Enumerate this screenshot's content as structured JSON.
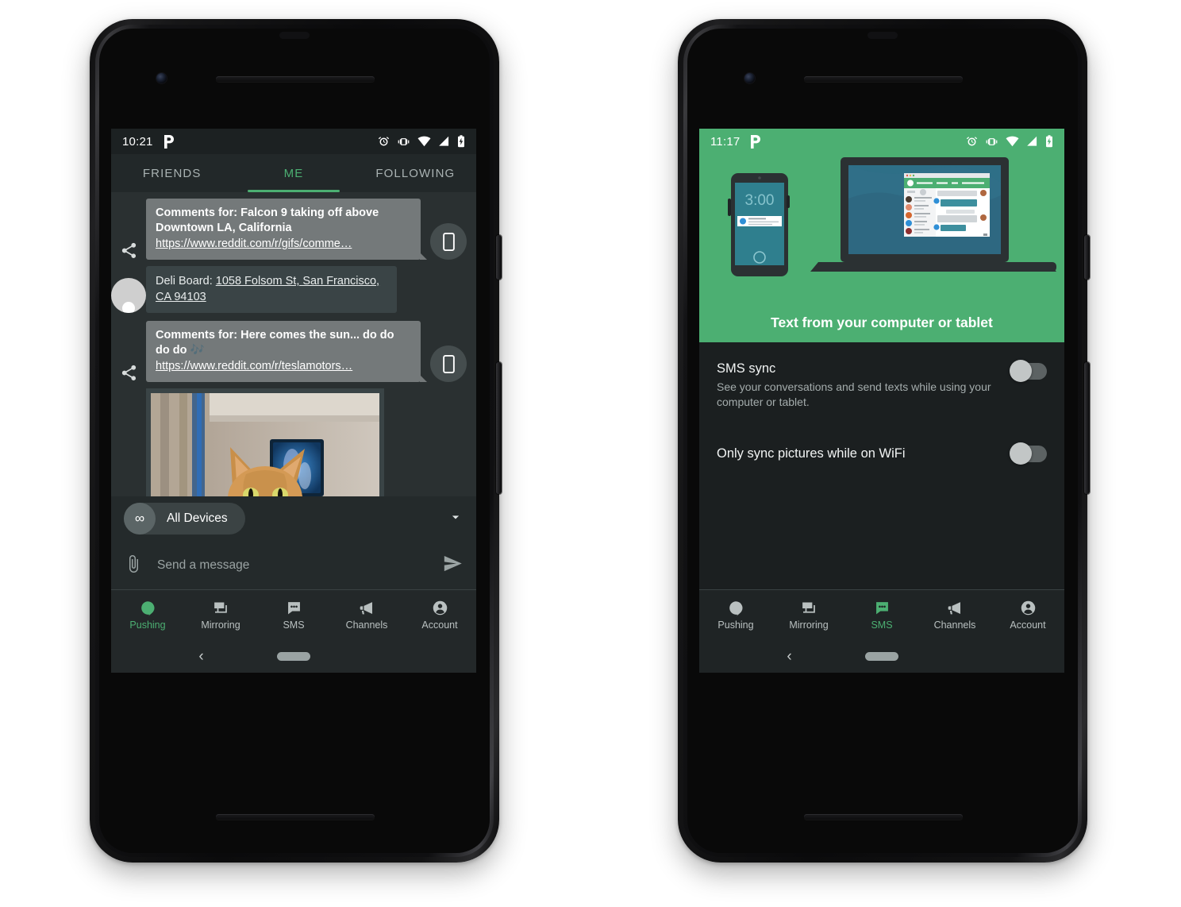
{
  "left_phone": {
    "status_bar": {
      "time": "10:21",
      "app_badge": "P",
      "icons": [
        "alarm-icon",
        "vibrate-icon",
        "wifi-icon",
        "signal-icon",
        "battery-charging-icon"
      ]
    },
    "tabs": [
      {
        "label": "FRIENDS",
        "active": false
      },
      {
        "label": "ME",
        "active": true
      },
      {
        "label": "FOLLOWING",
        "active": false
      }
    ],
    "messages": [
      {
        "type": "shared-link",
        "lead_icon": "share-icon",
        "title": "Comments for: Falcon 9 taking off above Downtown LA, California",
        "link": "https://www.reddit.com/r/gifs/comme…",
        "device_button_icon": "phone-icon"
      },
      {
        "type": "plain",
        "lead_icon": "avatar",
        "body": "Deli Board: 1058 Folsom St, San Francisco, CA 94103",
        "body_prefix": "Deli Board: ",
        "body_link": "1058 Folsom St, San Francisco, CA 94103"
      },
      {
        "type": "shared-link",
        "lead_icon": "share-icon",
        "title": "Comments for: Here comes the sun... do do do do 🎶",
        "link": "https://www.reddit.com/r/teslamotors…",
        "device_button_icon": "phone-icon"
      },
      {
        "type": "photo",
        "alt": "Photo of an orange tabby cat in front of a TV",
        "share_icon": "share-icon"
      }
    ],
    "composer": {
      "device_chip_badge": "∞",
      "device_chip_label": "All Devices",
      "dropdown_icon": "chevron-down-icon",
      "attach_icon": "paperclip-icon",
      "input_placeholder": "Send a message",
      "input_value": "",
      "send_icon": "send-icon"
    },
    "bottom_nav": [
      {
        "label": "Pushing",
        "icon": "chat-bubble-icon",
        "active": true
      },
      {
        "label": "Mirroring",
        "icon": "monitor-icon",
        "active": false
      },
      {
        "label": "SMS",
        "icon": "sms-icon",
        "active": false
      },
      {
        "label": "Channels",
        "icon": "megaphone-icon",
        "active": false
      },
      {
        "label": "Account",
        "icon": "account-icon",
        "active": false
      }
    ],
    "system_nav": {
      "back_icon": "chevron-left-icon",
      "home_pill": "home-pill"
    }
  },
  "right_phone": {
    "status_bar": {
      "time": "11:17",
      "app_badge": "P",
      "icons": [
        "alarm-icon",
        "vibrate-icon",
        "wifi-icon",
        "signal-icon",
        "battery-charging-icon"
      ]
    },
    "hero": {
      "caption": "Text from your computer or tablet",
      "phone_mock_time": "3:00",
      "illustration": "phone-and-laptop-illustration"
    },
    "settings": [
      {
        "title": "SMS sync",
        "subtitle": "See your conversations and send texts while using your computer or tablet.",
        "toggle_state": "off"
      },
      {
        "title": "Only sync pictures while on WiFi",
        "subtitle": "",
        "toggle_state": "off"
      }
    ],
    "bottom_nav": [
      {
        "label": "Pushing",
        "icon": "chat-bubble-icon",
        "active": false
      },
      {
        "label": "Mirroring",
        "icon": "monitor-icon",
        "active": false
      },
      {
        "label": "SMS",
        "icon": "sms-icon",
        "active": true
      },
      {
        "label": "Channels",
        "icon": "megaphone-icon",
        "active": false
      },
      {
        "label": "Account",
        "icon": "account-icon",
        "active": false
      }
    ],
    "system_nav": {
      "back_icon": "chevron-left-icon",
      "home_pill": "home-pill"
    }
  },
  "colors": {
    "accent_green": "#4caf72",
    "screen_dark": "#222829",
    "thread_bg": "#2a3031",
    "bubble_shared": "#74797a",
    "bubble_plain": "#3a4446",
    "page_bg": "#ffffff"
  }
}
